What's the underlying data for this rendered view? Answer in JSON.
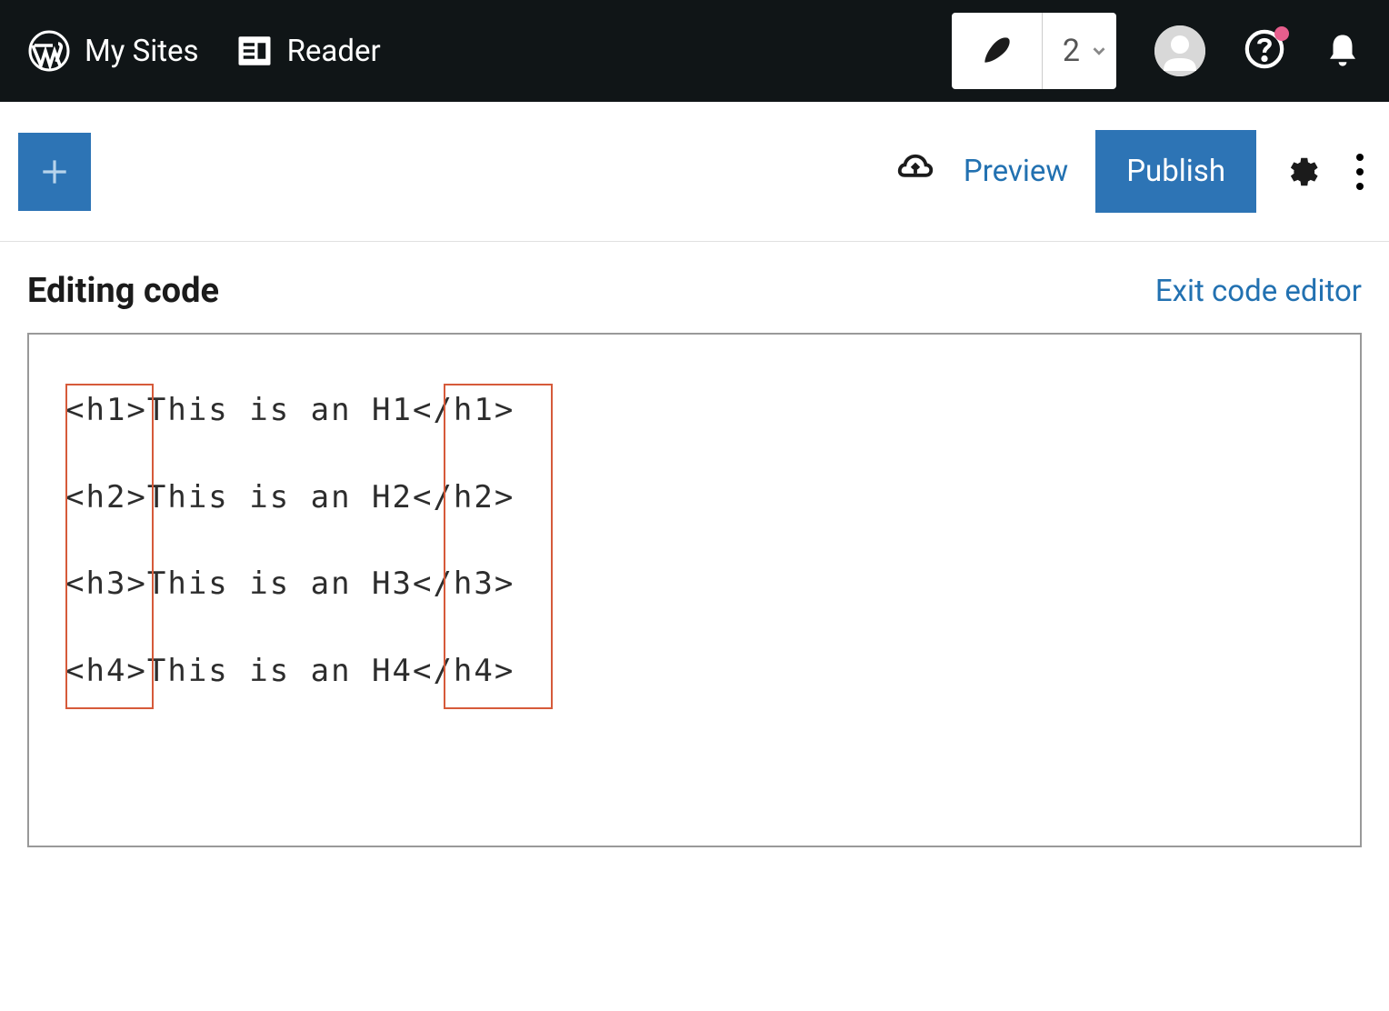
{
  "admin_bar": {
    "my_sites": "My Sites",
    "reader": "Reader",
    "write_count": "2"
  },
  "editor_header": {
    "preview": "Preview",
    "publish": "Publish"
  },
  "code_editor": {
    "editing_label": "Editing code",
    "exit_label": "Exit code editor",
    "lines": [
      "<h1>This is an H1</h1>",
      "<h2>This is an H2</h2>",
      "<h3>This is an H3</h3>",
      "<h4>This is an H4</h4>"
    ]
  }
}
